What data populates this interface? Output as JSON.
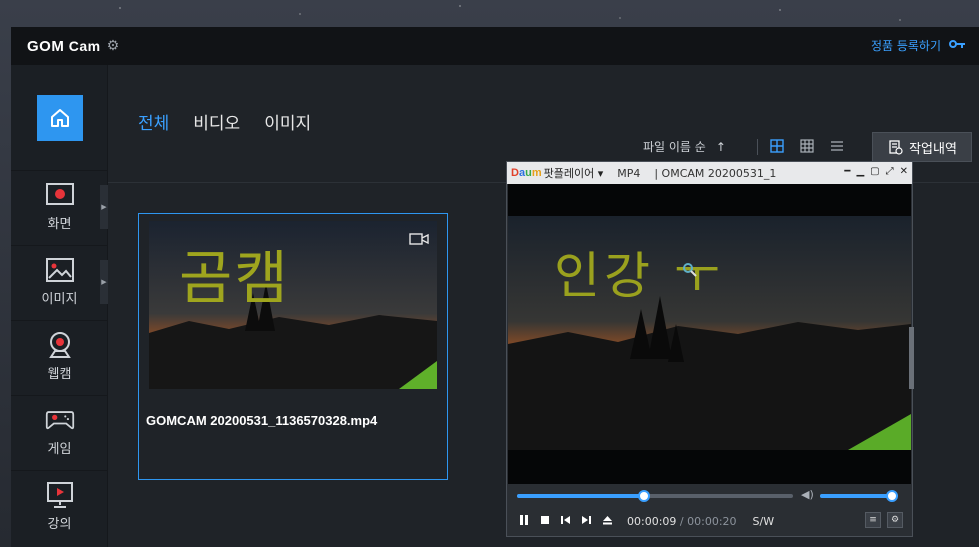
{
  "app": {
    "logo_gom": "GOM",
    "logo_cam": " Cam",
    "register_label": "정품 등록하기"
  },
  "sidebar": {
    "items": [
      {
        "label": "화면",
        "icon": "screen-record-icon"
      },
      {
        "label": "이미지",
        "icon": "image-icon"
      },
      {
        "label": "웹캠",
        "icon": "webcam-icon"
      },
      {
        "label": "게임",
        "icon": "gamepad-icon"
      },
      {
        "label": "강의",
        "icon": "lecture-icon"
      }
    ]
  },
  "main": {
    "tabs": [
      {
        "label": "전체",
        "active": true
      },
      {
        "label": "비디오",
        "active": false
      },
      {
        "label": "이미지",
        "active": false
      }
    ],
    "sort_label": "파일 이름 순",
    "sort_arrow": "↑",
    "history_label": "작업내역",
    "card": {
      "thumb_text": "곰캠",
      "file_name": "GOMCAM 20200531_1136570328.mp4"
    }
  },
  "player": {
    "brand_d": "D",
    "brand_a": "a",
    "brand_u": "u",
    "brand_m": "m",
    "player_name": "팟플레이어 ▾",
    "format": "MP4",
    "file_name": "| OMCAM 20200531_1",
    "overlay_text": "인강 ㅜ",
    "current_time": "00:00:09",
    "separator": "/",
    "total_time": "00:00:20",
    "mode_label": "S/W",
    "seek_progress": 0.46,
    "volume_level": 1.0
  },
  "colors": {
    "accent": "#2e96f0",
    "link": "#3aa0ff"
  }
}
